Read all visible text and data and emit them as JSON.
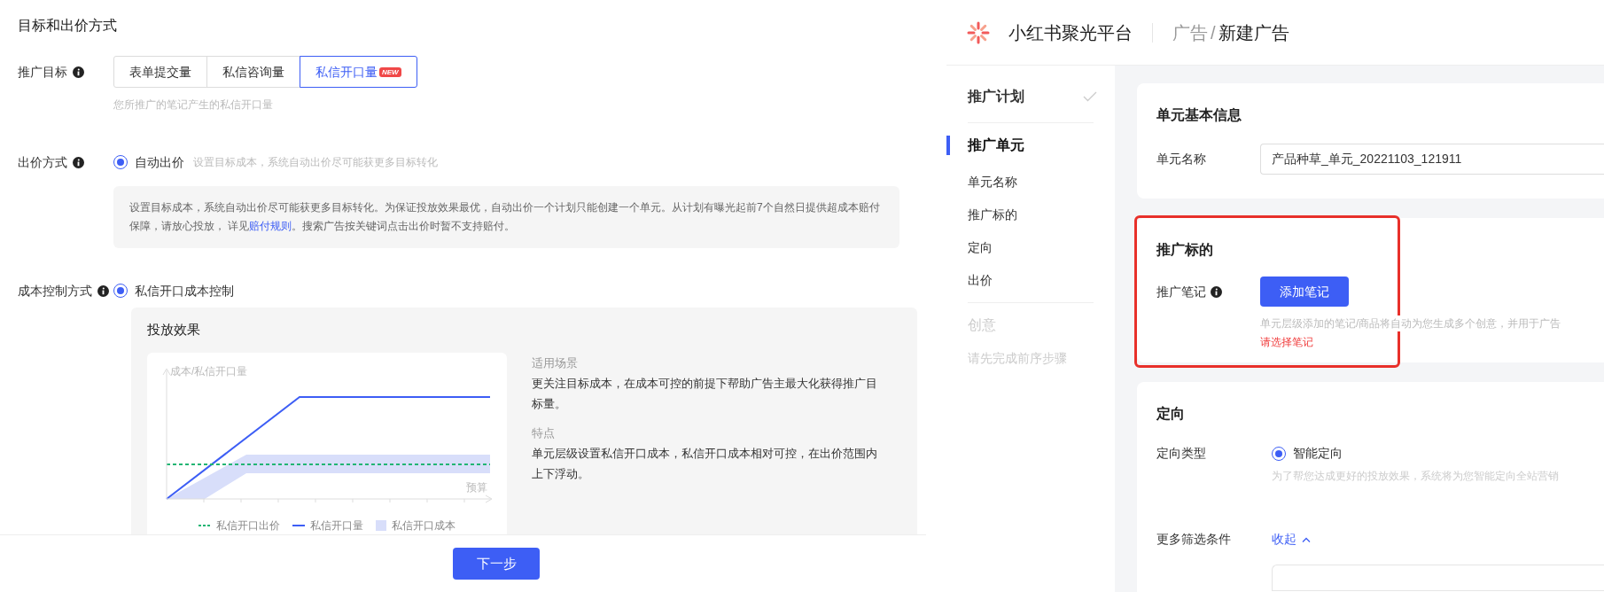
{
  "left": {
    "section_title": "目标和出价方式",
    "goal": {
      "label": "推广目标",
      "options": [
        {
          "label": "表单提交量",
          "selected": false
        },
        {
          "label": "私信咨询量",
          "selected": false
        },
        {
          "label": "私信开口量",
          "selected": true,
          "badge": "NEW"
        }
      ],
      "hint": "您所推广的笔记产生的私信开口量"
    },
    "bid": {
      "label": "出价方式",
      "option": {
        "label": "自动出价",
        "selected": true
      },
      "option_hint": "设置目标成本，系统自动出价尽可能获更多目标转化",
      "notice_before": "设置目标成本，系统自动出价尽可能获更多目标转化。为保证投放效果最优，自动出价一个计划只能创建一个单元。从计划有曝光起前7个自然日提供超成本赔付保障，请放心投放， 详见",
      "notice_link": "赔付规则",
      "notice_after": "。搜索广告按关键词点击出价时暂不支持赔付。"
    },
    "cost_control": {
      "label": "成本控制方式",
      "option": {
        "label": "私信开口成本控制",
        "selected": true
      }
    },
    "effect": {
      "title": "投放效果",
      "y_axis": "成本/私信开口量",
      "x_axis": "预算",
      "legend": [
        {
          "label": "私信开口出价",
          "kind": "dashed",
          "color": "#22b573"
        },
        {
          "label": "私信开口量",
          "kind": "line",
          "color": "#3d5ef5"
        },
        {
          "label": "私信开口成本",
          "kind": "band",
          "color": "#d8defa"
        }
      ],
      "scene_title": "适用场景",
      "scene_text": "更关注目标成本，在成本可控的前提下帮助广告主最大化获得推广目标量。",
      "feature_title": "特点",
      "feature_text": "单元层级设置私信开口成本，私信开口成本相对可控，在出价范围内上下浮动。"
    },
    "next_button": "下一步"
  },
  "right": {
    "brand": "小红书聚光平台",
    "breadcrumb": {
      "items": [
        "广告",
        "新建广告"
      ],
      "separator": "/"
    },
    "steps": [
      {
        "label": "推广计划",
        "selected": false,
        "done": true,
        "disabled": false
      },
      {
        "label": "推广单元",
        "selected": true,
        "done": false,
        "disabled": false,
        "children": [
          {
            "label": "单元名称"
          },
          {
            "label": "推广标的"
          },
          {
            "label": "定向"
          },
          {
            "label": "出价"
          }
        ]
      },
      {
        "label": "创意",
        "selected": false,
        "done": false,
        "disabled": true,
        "note": "请先完成前序步骤"
      }
    ],
    "basic": {
      "title": "单元基本信息",
      "name_label": "单元名称",
      "name_value": "产品种草_单元_20221103_121911"
    },
    "target": {
      "title": "推广标的",
      "highlighted": true,
      "note_label": "推广笔记",
      "add_button": "添加笔记",
      "hint": "单元层级添加的笔记/商品将自动为您生成多个创意，并用于广告",
      "error": "请选择笔记"
    },
    "targeting": {
      "title": "定向",
      "type_label": "定向类型",
      "type_option": {
        "label": "智能定向",
        "selected": true
      },
      "type_hint": "为了帮您达成更好的投放效果，系统将为您智能定向全站营销",
      "filter_label": "更多筛选条件",
      "collapse_link": "收起"
    }
  }
}
